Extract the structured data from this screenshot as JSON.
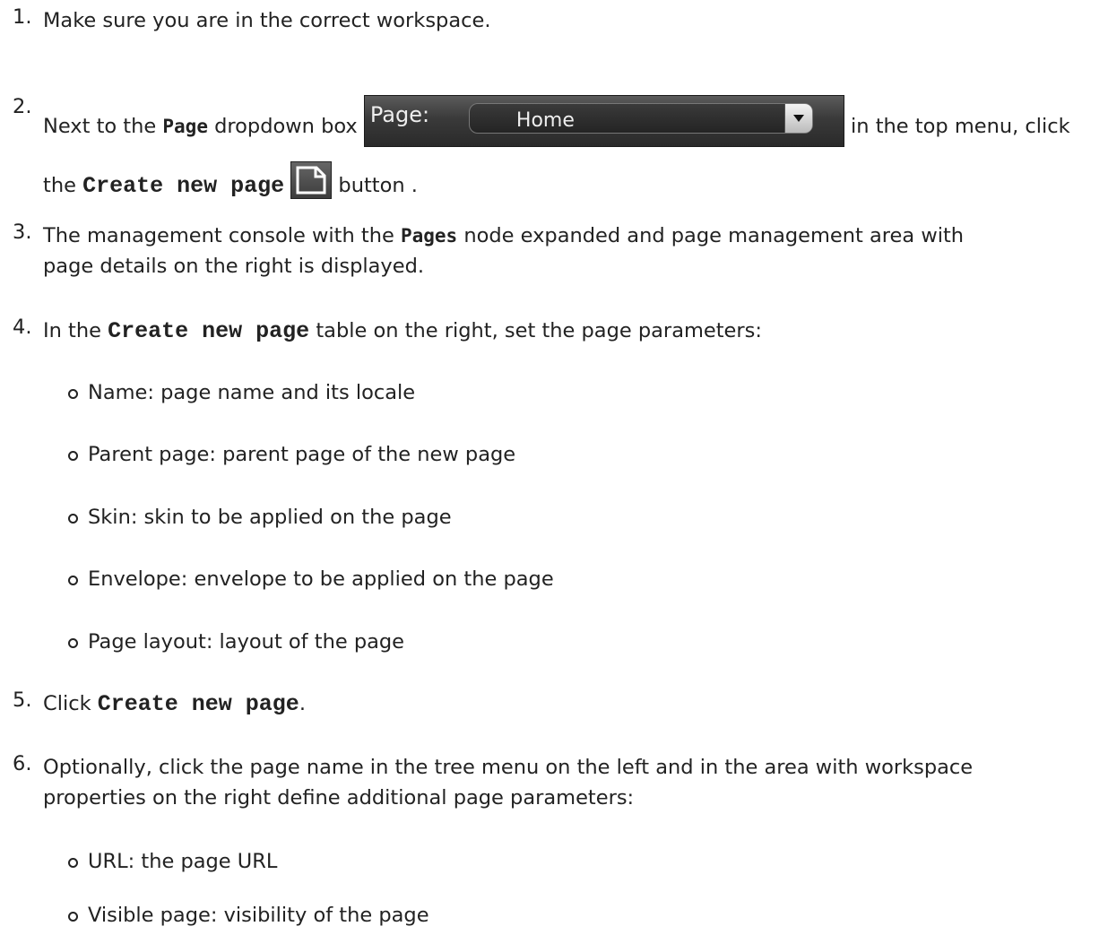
{
  "steps": [
    {
      "num": "1.",
      "text": "Make sure you are in the correct workspace."
    },
    {
      "num": "2.",
      "p1": "Next to the ",
      "bold1": "Page",
      "p2": " dropdown box ",
      "p3": " in the top menu, click",
      "p4": "the ",
      "code1": "Create new page",
      "p5": " button ."
    },
    {
      "num": "3.",
      "p1": "The management console with the ",
      "bold1": "Pages",
      "p2": " node expanded and page management area with",
      "p3": "page details on the right is displayed."
    },
    {
      "num": "4.",
      "p1": "In the ",
      "code1": "Create new page",
      "p2": " table on the right, set the page parameters:",
      "sub": [
        "Name: page name and its locale",
        "Parent page: parent page of the new page",
        "Skin: skin to be applied on the page",
        "Envelope: envelope to be applied on the page",
        "Page layout: layout of the page"
      ]
    },
    {
      "num": "5.",
      "p1": "Click ",
      "code1": "Create new page",
      "p2": "."
    },
    {
      "num": "6.",
      "p1": "Optionally, click the page name in the tree menu on the left and in the area with workspace",
      "p2": "properties on the right define additional page parameters:",
      "sub": [
        "URL: the page URL",
        "Visible page: visibility of the page"
      ]
    }
  ],
  "page_widget": {
    "label": "Page:",
    "selected": "Home"
  },
  "icons": {
    "dropdown": "chevron-down-icon",
    "new_page": "new-page-icon"
  }
}
